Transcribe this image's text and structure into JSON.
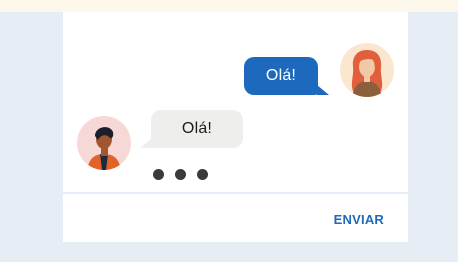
{
  "chat": {
    "messages": [
      {
        "text": "Olá!",
        "from": "sender"
      },
      {
        "text": "Olá!",
        "from": "receiver"
      }
    ],
    "typing_indicator": true,
    "send_label": "ENVIAR",
    "colors": {
      "accent": "#1d69be",
      "incoming_bubble": "#eeeeed",
      "page_background": "#e7edf5"
    },
    "icons": {
      "sender_avatar": "woman-red-hair-avatar-icon",
      "receiver_avatar": "man-dark-hair-avatar-icon"
    }
  }
}
